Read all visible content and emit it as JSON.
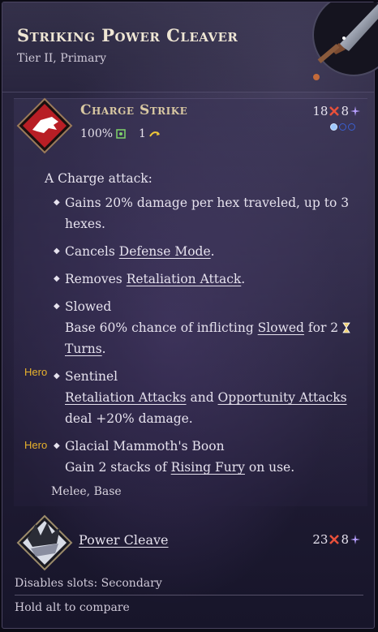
{
  "item": {
    "title": "Striking Power Cleaver",
    "subtitle": "Tier II, Primary"
  },
  "ability": {
    "name": "Charge Strike",
    "accuracy": "100%",
    "range": "1",
    "cost_red": "18",
    "cost_purple": "8",
    "pips_total": 3,
    "pips_filled": 1,
    "intro": "A Charge attack:",
    "bullets": [
      {
        "prefix": "",
        "text": "Gains 20% damage per hex traveled, up to 3 hexes."
      },
      {
        "prefix": "Cancels ",
        "link": "Defense Mode",
        "suffix": "."
      },
      {
        "prefix": "Removes ",
        "link": "Retaliation Attack",
        "suffix": "."
      },
      {
        "line1": "Slowed",
        "prefix": "Base 60% chance of inflicting ",
        "link": "Slowed",
        "mid": " for 2 ",
        "link2": "Turns",
        "suffix": "."
      },
      {
        "hero": "Hero",
        "line1": "Sentinel",
        "link": "Retaliation Attacks",
        "mid": " and ",
        "link2": "Opportunity Attacks",
        "suffix": "deal +20% damage."
      },
      {
        "hero": "Hero",
        "line1": "Glacial Mammoth's Boon",
        "prefix": "Gain 2 stacks of ",
        "link": "Rising Fury",
        "suffix": " on use."
      }
    ],
    "tags": "Melee, Base"
  },
  "alt_ability": {
    "name": "Power Cleave",
    "cost_red": "23",
    "cost_purple": "8"
  },
  "footer": {
    "disables": "Disables slots: Secondary",
    "compare": "Hold alt to compare"
  },
  "colors": {
    "accent_gold": "#e8b22c",
    "cost_red": "#e8503a",
    "cost_purple": "#b8a0ff",
    "ability_icon_red": "#b81e25"
  }
}
